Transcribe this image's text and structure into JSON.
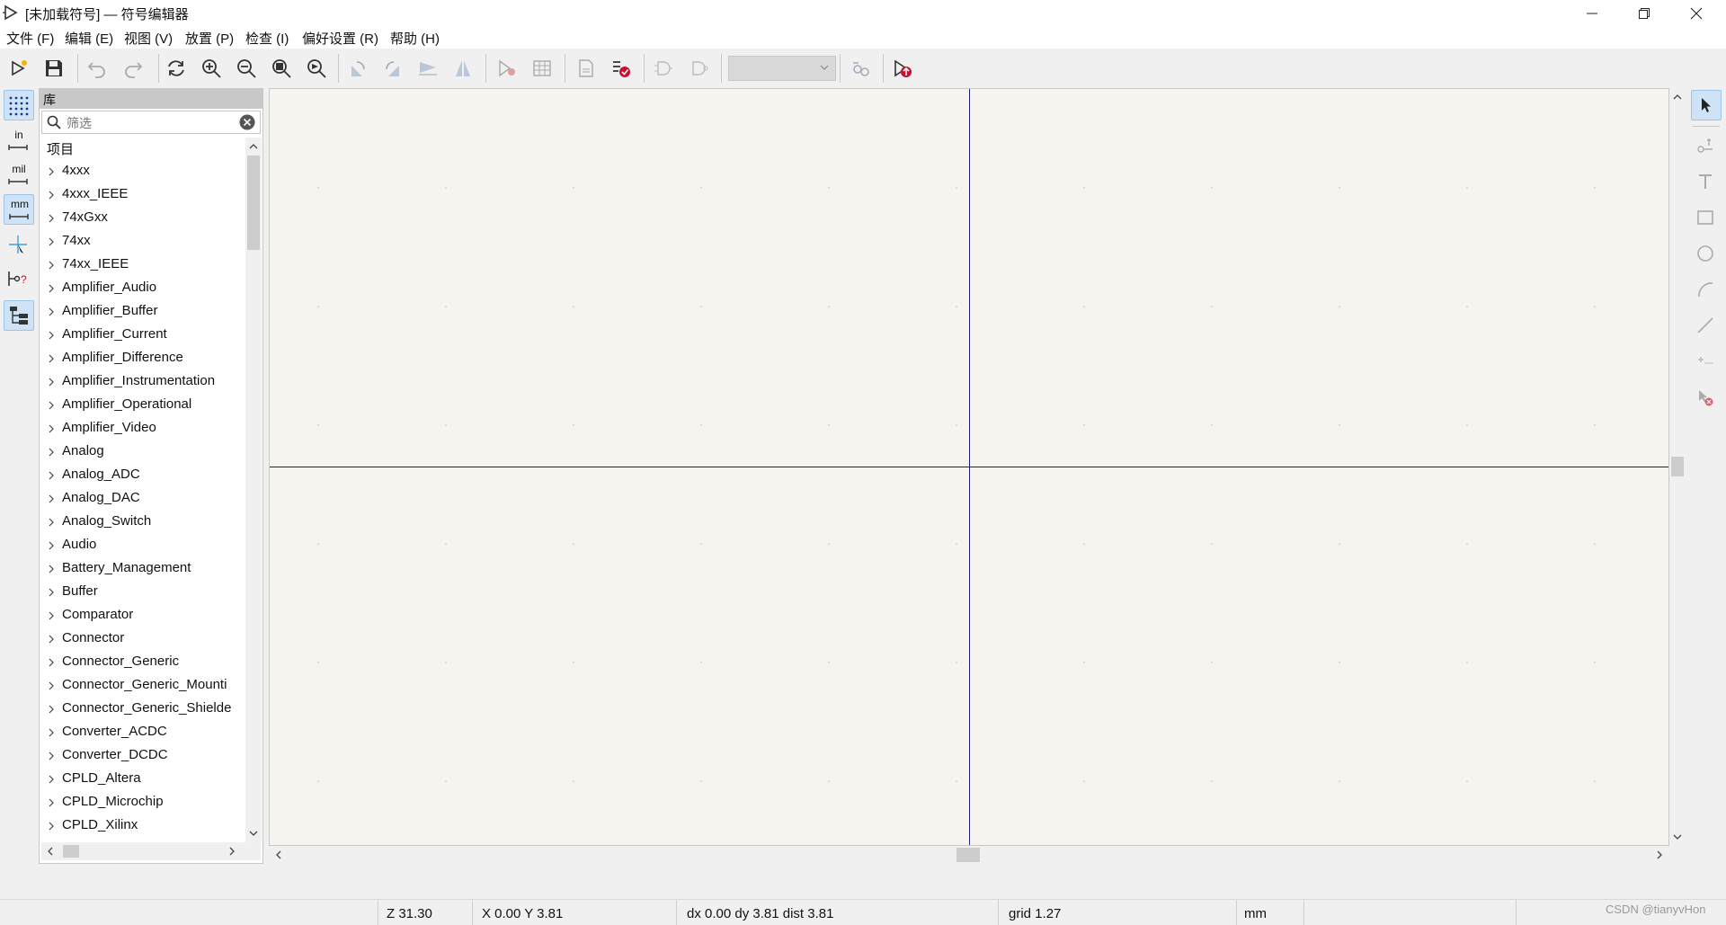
{
  "window": {
    "title": "[未加载符号] — 符号编辑器"
  },
  "menu": [
    "文件 (F)",
    "编辑 (E)",
    "视图 (V)",
    "放置 (P)",
    "检查 (I)",
    "偏好设置 (R)",
    "帮助 (H)"
  ],
  "toolbar": {
    "buttons": [
      "new-symbol-icon",
      "save-icon",
      "undo-icon",
      "redo-icon",
      "refresh-icon",
      "zoom-in-icon",
      "zoom-out-icon",
      "zoom-fit-icon",
      "zoom-object-icon",
      "rotate-ccw-icon",
      "rotate-cw-icon",
      "mirror-horizontal-icon",
      "mirror-vertical-icon",
      "symbol-properties-icon",
      "pin-table-icon",
      "datasheet-icon",
      "check-symbol-icon",
      "show-de-morgan-standard-icon",
      "show-de-morgan-alternate-icon",
      "sync-pins-icon",
      "add-to-schematic-icon"
    ],
    "unit_select_value": ""
  },
  "left_toolbar": [
    {
      "name": "grid-toggle-icon",
      "text": "",
      "active": true
    },
    {
      "name": "units-inches-icon",
      "text": "in",
      "active": false
    },
    {
      "name": "units-mils-icon",
      "text": "mil",
      "active": false
    },
    {
      "name": "units-mm-icon",
      "text": "mm",
      "active": true
    },
    {
      "name": "cursor-fullscreen-icon",
      "text": "",
      "active": false
    },
    {
      "name": "show-electrical-type-icon",
      "text": "",
      "active": false
    },
    {
      "name": "show-library-tree-icon",
      "text": "",
      "active": true
    }
  ],
  "library": {
    "title": "库",
    "filter_placeholder": "筛选",
    "tree_header": "项目",
    "items": [
      "4xxx",
      "4xxx_IEEE",
      "74xGxx",
      "74xx",
      "74xx_IEEE",
      "Amplifier_Audio",
      "Amplifier_Buffer",
      "Amplifier_Current",
      "Amplifier_Difference",
      "Amplifier_Instrumentation",
      "Amplifier_Operational",
      "Amplifier_Video",
      "Analog",
      "Analog_ADC",
      "Analog_DAC",
      "Analog_Switch",
      "Audio",
      "Battery_Management",
      "Buffer",
      "Comparator",
      "Connector",
      "Connector_Generic",
      "Connector_Generic_Mounti",
      "Connector_Generic_Shielde",
      "Converter_ACDC",
      "Converter_DCDC",
      "CPLD_Altera",
      "CPLD_Microchip",
      "CPLD_Xilinx"
    ]
  },
  "right_toolbar": [
    {
      "name": "select-tool-icon",
      "active": true
    },
    {
      "name": "add-pin-icon",
      "active": false
    },
    {
      "name": "add-text-icon",
      "active": false
    },
    {
      "name": "add-rectangle-icon",
      "active": false
    },
    {
      "name": "add-circle-icon",
      "active": false
    },
    {
      "name": "add-arc-icon",
      "active": false
    },
    {
      "name": "add-line-icon",
      "active": false
    },
    {
      "name": "set-anchor-icon",
      "active": false
    },
    {
      "name": "delete-tool-icon",
      "active": false
    }
  ],
  "status": {
    "zoom": "Z 31.30",
    "xy": "X 0.00  Y 3.81",
    "delta": "dx 0.00  dy 3.81  dist 3.81",
    "grid": "grid 1.27",
    "units": "mm"
  },
  "watermark": "CSDN @tianyvHon",
  "colors": {
    "canvas": "#f5f4ef",
    "axis": "#1c1c7c",
    "active_tool": "#cfe3f7"
  }
}
